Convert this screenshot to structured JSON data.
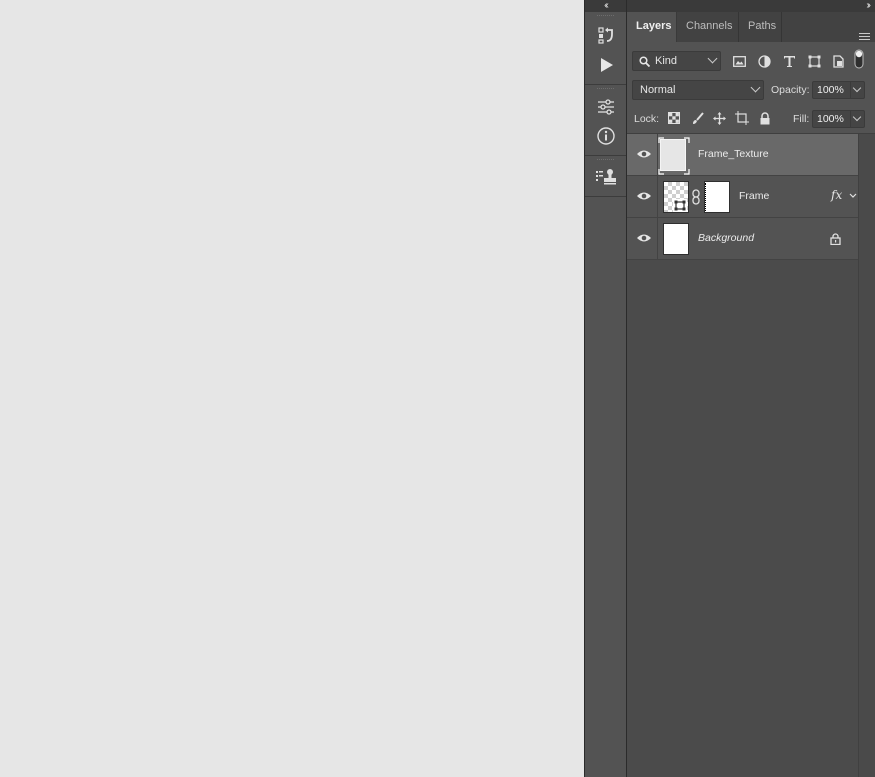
{
  "panel": {
    "tabs": [
      {
        "label": "Layers",
        "active": true
      },
      {
        "label": "Channels",
        "active": false
      },
      {
        "label": "Paths",
        "active": false
      }
    ],
    "filter": {
      "label": "Kind"
    },
    "blend_mode": "Normal",
    "opacity_label": "Opacity:",
    "opacity_value": "100%",
    "lock_label": "Lock:",
    "fill_label": "Fill:",
    "fill_value": "100%",
    "fx_label": "fx"
  },
  "layers": [
    {
      "name": "Frame_Texture",
      "selected": true,
      "visible": true
    },
    {
      "name": "Frame",
      "selected": false,
      "visible": true,
      "has_mask": true,
      "has_fx": true
    },
    {
      "name": "Background",
      "selected": false,
      "visible": true,
      "locked": true
    }
  ],
  "colors": {
    "panel_bg": "#535353",
    "selected_row": "#696969",
    "canvas_bg": "#e6e6e6"
  }
}
